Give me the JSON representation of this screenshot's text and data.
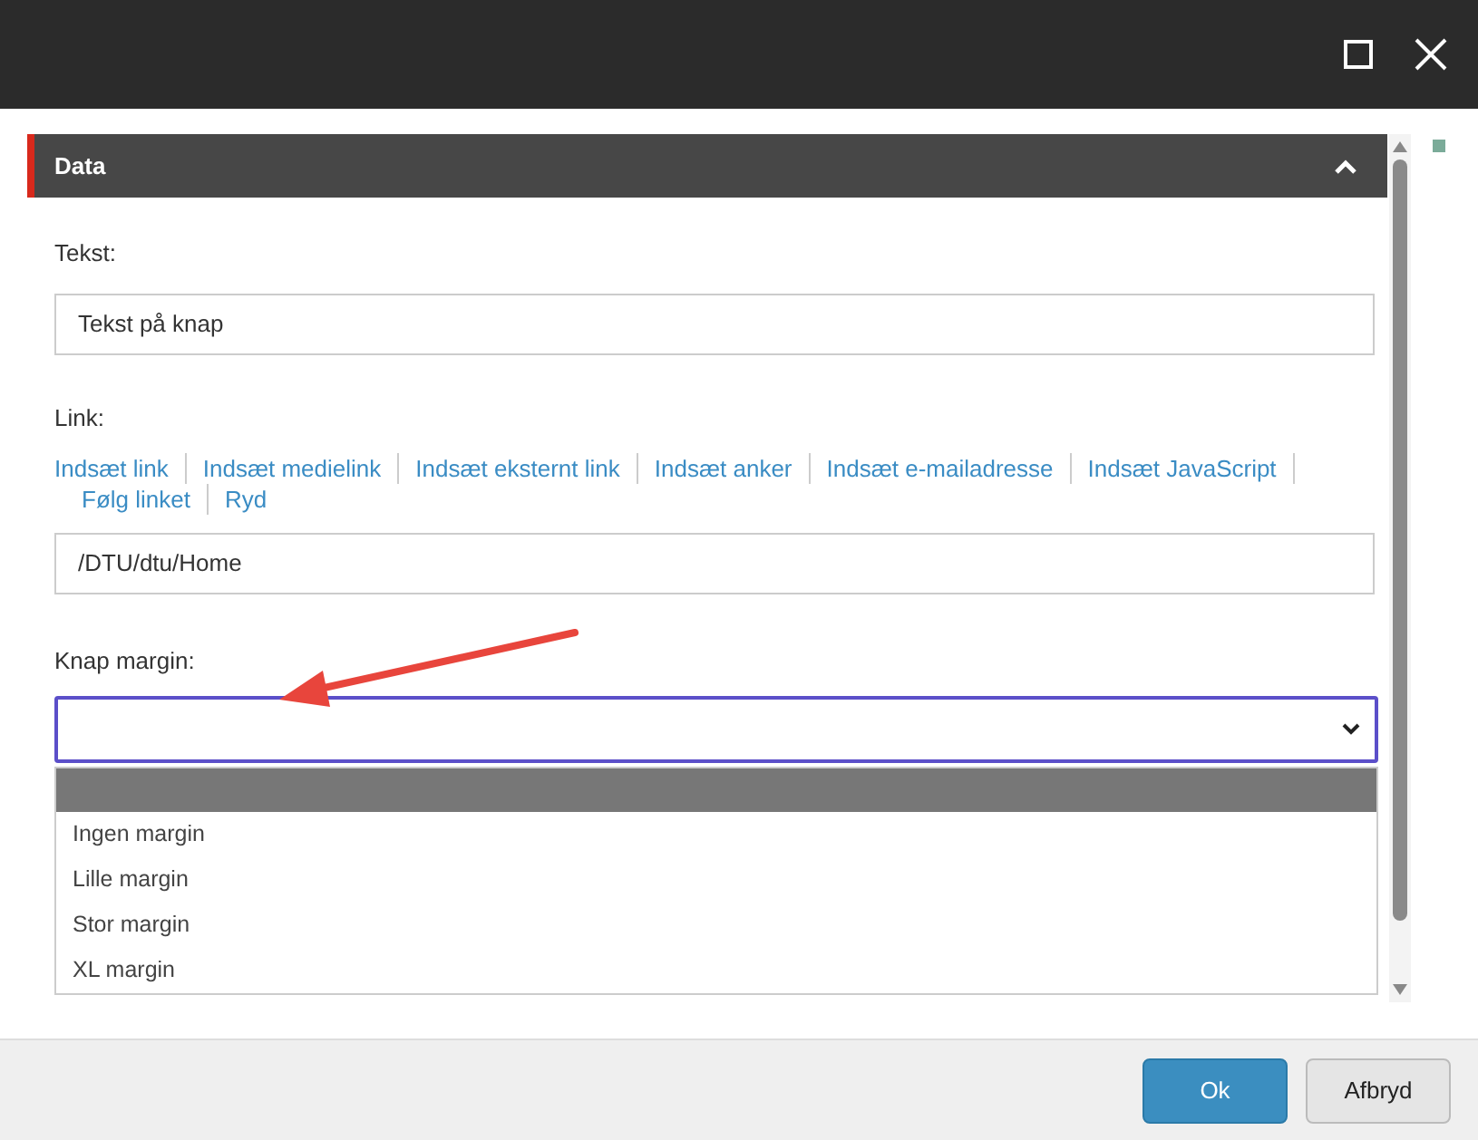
{
  "section": {
    "title": "Data",
    "expanded": true
  },
  "text_field": {
    "label": "Tekst:",
    "value": "Tekst på knap"
  },
  "link_field": {
    "label": "Link:",
    "actions": [
      "Indsæt link",
      "Indsæt medielink",
      "Indsæt eksternt link",
      "Indsæt anker",
      "Indsæt e-mailadresse",
      "Indsæt JavaScript",
      "Følg linket",
      "Ryd"
    ],
    "value": "/DTU/dtu/Home"
  },
  "margin_select": {
    "label": "Knap margin:",
    "options": [
      {
        "label": "Ingen margin",
        "selected": false
      },
      {
        "label": "Lille margin",
        "selected": false
      },
      {
        "label": "Stor margin",
        "selected": false
      },
      {
        "label": "XL margin",
        "selected": false
      }
    ]
  },
  "buttons": [
    {
      "label": "Ok",
      "kind": "primary"
    },
    {
      "label": "Afbryd",
      "kind": "secondary"
    }
  ]
}
